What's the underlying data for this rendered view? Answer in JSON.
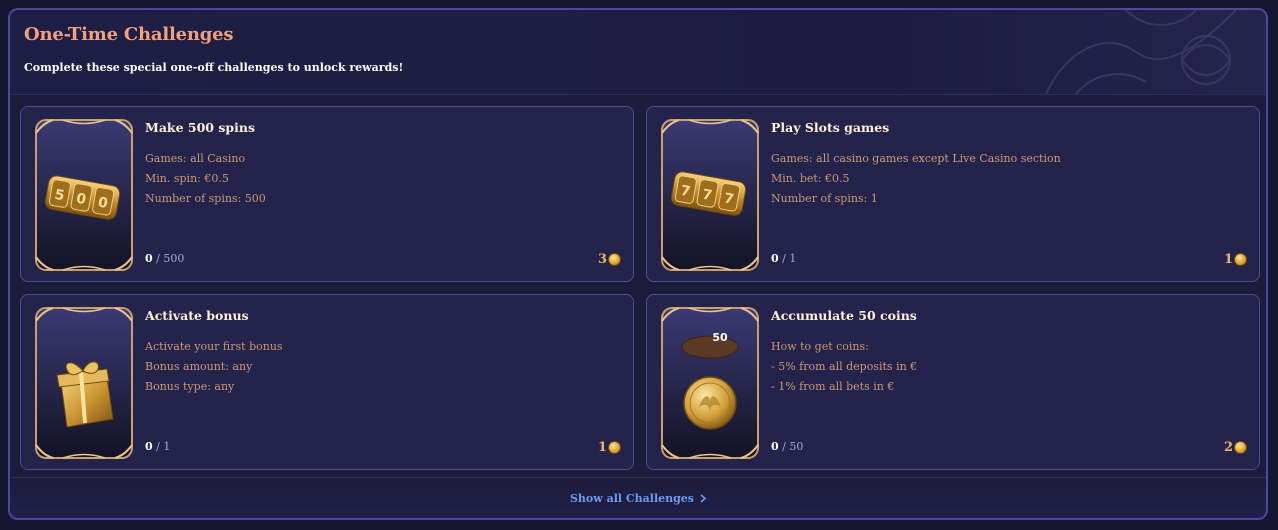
{
  "header": {
    "title": "One-Time Challenges",
    "subtitle": "Complete these special one-off challenges to unlock rewards!"
  },
  "challenges": [
    {
      "name": "Make 500 spins",
      "details": [
        "Games: all Casino",
        "Min. spin: €0.5",
        "Number of spins: 500"
      ],
      "progress_current": "0",
      "progress_total": "/ 500",
      "reward": "3",
      "image_icon": "slot-reel-500-icon"
    },
    {
      "name": "Play Slots games",
      "details": [
        "Games: all casino games except Live Casino section",
        "Min. bet: €0.5",
        "Number of spins: 1"
      ],
      "progress_current": "0",
      "progress_total": "/ 1",
      "reward": "1",
      "image_icon": "slot-reel-777-icon"
    },
    {
      "name": "Activate bonus",
      "details": [
        "Activate your first bonus",
        "Bonus amount: any",
        "Bonus type: any"
      ],
      "progress_current": "0",
      "progress_total": "/ 1",
      "reward": "1",
      "image_icon": "gift-box-icon"
    },
    {
      "name": "Accumulate 50 coins",
      "details": [
        "How to get coins:",
        "- 5% from all deposits in €",
        "- 1% from all bets in €"
      ],
      "progress_current": "0",
      "progress_total": "/ 50",
      "reward": "2",
      "image_icon": "gold-coin-icon",
      "image_badge": "50"
    }
  ],
  "footer": {
    "show_all_label": "Show all Challenges",
    "show_all_icon": "chevron-right-icon"
  },
  "colors": {
    "title": "#f0a17e",
    "detail_text": "#c99a74",
    "link": "#6f9cf0",
    "card_border": "#4c4b9c"
  }
}
